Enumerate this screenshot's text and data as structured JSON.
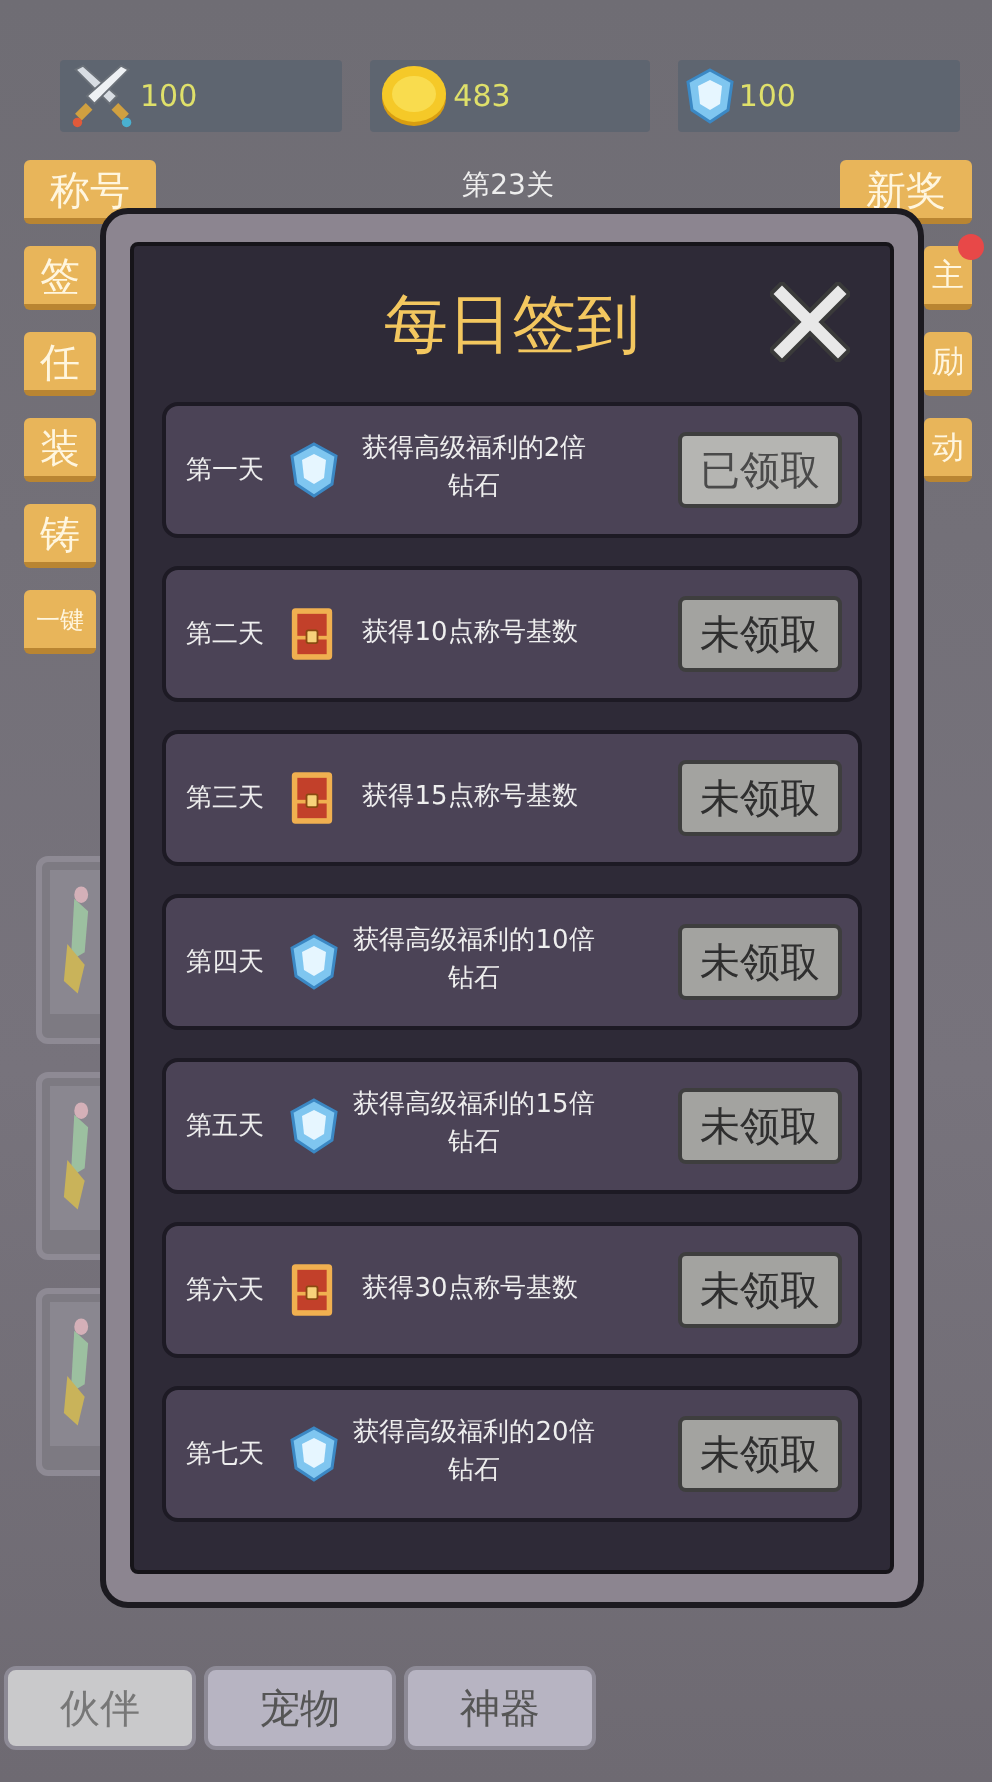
{
  "resources": [
    {
      "kind": "swords",
      "value": "100"
    },
    {
      "kind": "coin",
      "value": "483"
    },
    {
      "kind": "gem",
      "value": "100"
    }
  ],
  "stage": "第23关",
  "left_buttons": [
    {
      "label": "称号"
    },
    {
      "label": "签"
    },
    {
      "label": "任"
    },
    {
      "label": "装"
    },
    {
      "label": "铸"
    },
    {
      "label": "一键"
    }
  ],
  "right_buttons": [
    {
      "label": "新奖",
      "badge": false
    },
    {
      "label": "主",
      "badge": true
    },
    {
      "label": "励",
      "badge": false
    },
    {
      "label": "动",
      "badge": false
    }
  ],
  "dialog": {
    "title": "每日签到",
    "days": [
      {
        "day": "第一天",
        "kind": "gem",
        "reward": "获得高级福利的2倍钻石",
        "button": "已领取",
        "claimed": true
      },
      {
        "day": "第二天",
        "kind": "chest",
        "reward": "获得10点称号基数",
        "button": "未领取",
        "claimed": false
      },
      {
        "day": "第三天",
        "kind": "chest",
        "reward": "获得15点称号基数",
        "button": "未领取",
        "claimed": false
      },
      {
        "day": "第四天",
        "kind": "gem",
        "reward": "获得高级福利的10倍钻石",
        "button": "未领取",
        "claimed": false
      },
      {
        "day": "第五天",
        "kind": "gem",
        "reward": "获得高级福利的15倍钻石",
        "button": "未领取",
        "claimed": false
      },
      {
        "day": "第六天",
        "kind": "chest",
        "reward": "获得30点称号基数",
        "button": "未领取",
        "claimed": false
      },
      {
        "day": "第七天",
        "kind": "gem",
        "reward": "获得高级福利的20倍钻石",
        "button": "未领取",
        "claimed": false
      }
    ]
  },
  "bottom_tabs": [
    {
      "label": "伙伴",
      "selected": true
    },
    {
      "label": "宠物",
      "selected": false
    },
    {
      "label": "神器",
      "selected": false
    }
  ]
}
